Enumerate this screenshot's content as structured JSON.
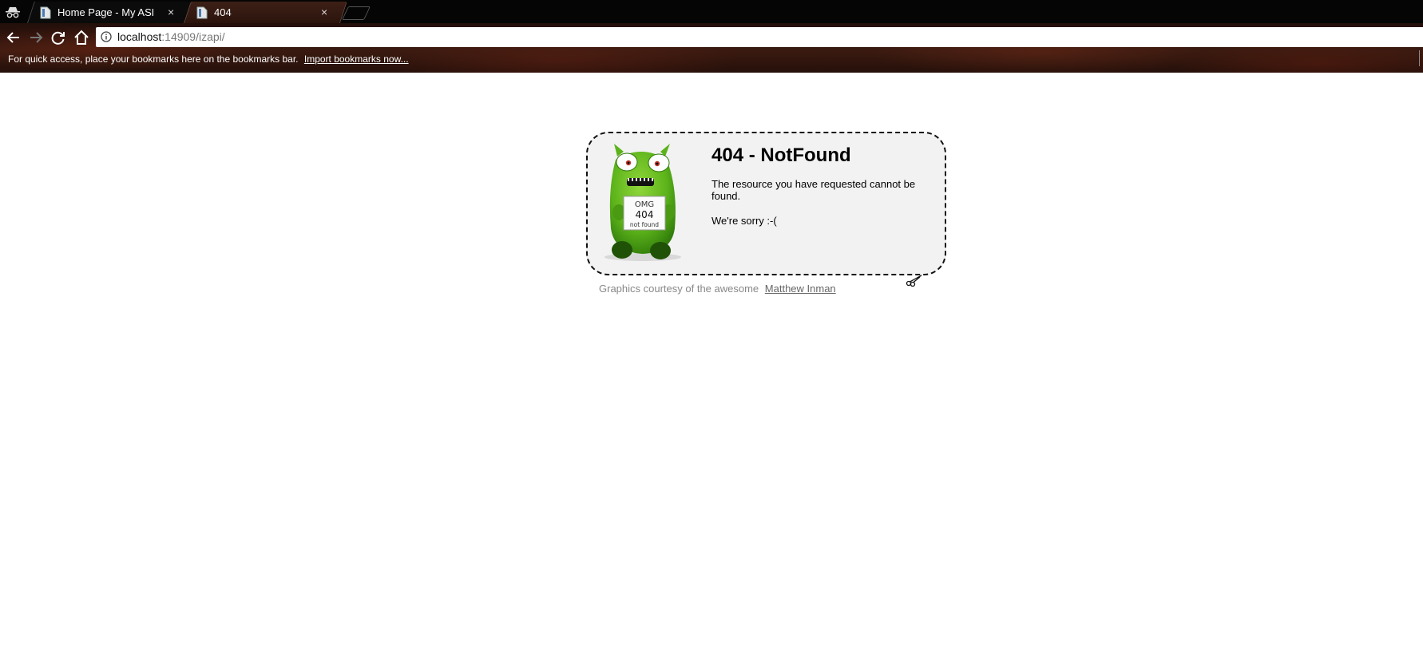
{
  "browser": {
    "tabs": [
      {
        "title": "Home Page - My ASP.NE",
        "active": false
      },
      {
        "title": "404",
        "active": true
      }
    ],
    "address": {
      "host": "localhost",
      "path": ":14909/izapi/"
    },
    "bookmarks_bar": {
      "message": "For quick access, place your bookmarks here on the bookmarks bar.",
      "import_link": "Import bookmarks now..."
    },
    "tab_close_glyph": "×",
    "icons": [
      "incognito-icon",
      "page-icon",
      "close-icon",
      "back-icon",
      "forward-icon",
      "reload-icon",
      "home-icon",
      "info-icon"
    ]
  },
  "page": {
    "title": "404 - NotFound",
    "message": "The resource you have requested cannot be found.",
    "apology": "We're sorry :-(",
    "sign": {
      "line1": "OMG",
      "line2": "404",
      "line3": "not found"
    },
    "credits": {
      "text": "Graphics courtesy of the awesome",
      "link": "Matthew Inman"
    },
    "colors": {
      "box_bg": "#f2f2f2",
      "monster_green": "#5cb31a"
    }
  }
}
